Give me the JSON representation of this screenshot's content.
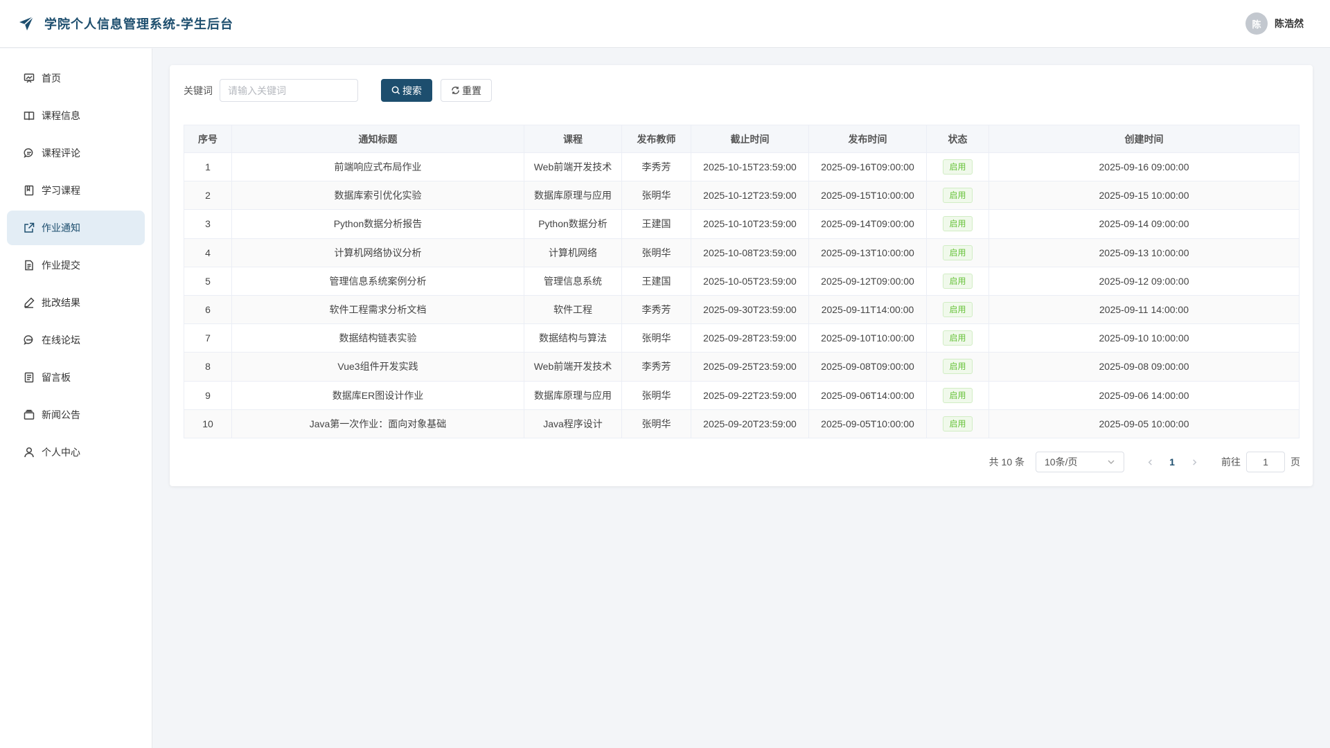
{
  "app": {
    "title": "学院个人信息管理系统-学生后台",
    "user": {
      "avatar_text": "陈",
      "name": "陈浩然"
    }
  },
  "sidebar": {
    "items": [
      {
        "label": "首页",
        "icon": "dashboard-icon",
        "active": false
      },
      {
        "label": "课程信息",
        "icon": "book-icon",
        "active": false
      },
      {
        "label": "课程评论",
        "icon": "comment-icon",
        "active": false
      },
      {
        "label": "学习课程",
        "icon": "notebook-icon",
        "active": false
      },
      {
        "label": "作业通知",
        "icon": "edit-notice-icon",
        "active": true
      },
      {
        "label": "作业提交",
        "icon": "document-icon",
        "active": false
      },
      {
        "label": "批改结果",
        "icon": "pen-icon",
        "active": false
      },
      {
        "label": "在线论坛",
        "icon": "chat-dots-icon",
        "active": false
      },
      {
        "label": "留言板",
        "icon": "memo-icon",
        "active": false
      },
      {
        "label": "新闻公告",
        "icon": "news-box-icon",
        "active": false
      },
      {
        "label": "个人中心",
        "icon": "user-icon",
        "active": false
      }
    ]
  },
  "search": {
    "label": "关键词",
    "placeholder": "请输入关键词",
    "value": "",
    "search_label": "搜索",
    "reset_label": "重置"
  },
  "table": {
    "columns": [
      "序号",
      "通知标题",
      "课程",
      "发布教师",
      "截止时间",
      "发布时间",
      "状态",
      "创建时间"
    ],
    "rows": [
      [
        "1",
        "前端响应式布局作业",
        "Web前端开发技术",
        "李秀芳",
        "2025-10-15T23:59:00",
        "2025-09-16T09:00:00",
        "启用",
        "2025-09-16 09:00:00"
      ],
      [
        "2",
        "数据库索引优化实验",
        "数据库原理与应用",
        "张明华",
        "2025-10-12T23:59:00",
        "2025-09-15T10:00:00",
        "启用",
        "2025-09-15 10:00:00"
      ],
      [
        "3",
        "Python数据分析报告",
        "Python数据分析",
        "王建国",
        "2025-10-10T23:59:00",
        "2025-09-14T09:00:00",
        "启用",
        "2025-09-14 09:00:00"
      ],
      [
        "4",
        "计算机网络协议分析",
        "计算机网络",
        "张明华",
        "2025-10-08T23:59:00",
        "2025-09-13T10:00:00",
        "启用",
        "2025-09-13 10:00:00"
      ],
      [
        "5",
        "管理信息系统案例分析",
        "管理信息系统",
        "王建国",
        "2025-10-05T23:59:00",
        "2025-09-12T09:00:00",
        "启用",
        "2025-09-12 09:00:00"
      ],
      [
        "6",
        "软件工程需求分析文档",
        "软件工程",
        "李秀芳",
        "2025-09-30T23:59:00",
        "2025-09-11T14:00:00",
        "启用",
        "2025-09-11 14:00:00"
      ],
      [
        "7",
        "数据结构链表实验",
        "数据结构与算法",
        "张明华",
        "2025-09-28T23:59:00",
        "2025-09-10T10:00:00",
        "启用",
        "2025-09-10 10:00:00"
      ],
      [
        "8",
        "Vue3组件开发实践",
        "Web前端开发技术",
        "李秀芳",
        "2025-09-25T23:59:00",
        "2025-09-08T09:00:00",
        "启用",
        "2025-09-08 09:00:00"
      ],
      [
        "9",
        "数据库ER图设计作业",
        "数据库原理与应用",
        "张明华",
        "2025-09-22T23:59:00",
        "2025-09-06T14:00:00",
        "启用",
        "2025-09-06 14:00:00"
      ],
      [
        "10",
        "Java第一次作业：面向对象基础",
        "Java程序设计",
        "张明华",
        "2025-09-20T23:59:00",
        "2025-09-05T10:00:00",
        "启用",
        "2025-09-05 10:00:00"
      ]
    ]
  },
  "pagination": {
    "total_text": "共 10 条",
    "page_size": "10条/页",
    "current_page": "1",
    "goto_label": "前往",
    "goto_value": "1",
    "page_suffix": "页"
  },
  "colors": {
    "primary": "#1d4e6e",
    "active_bg": "#e3edf5",
    "status_green": "#67c23a"
  }
}
